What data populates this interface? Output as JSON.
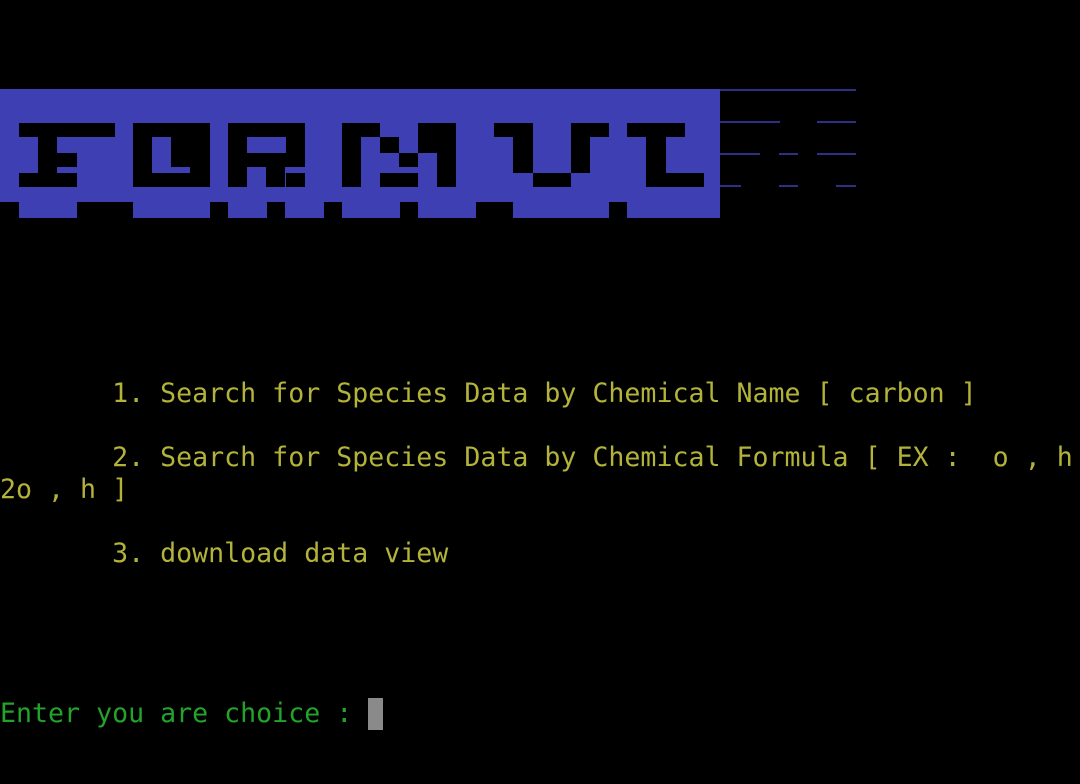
{
  "colors": {
    "background": "#000000",
    "menu_text": "#b3b33a",
    "prompt_text": "#22a32a",
    "banner": "#3f3fb4",
    "cursor": "#8a8a8a"
  },
  "banner": {
    "text": "FORMULA"
  },
  "menu": {
    "item1": "       1. Search for Species Data by Chemical Name [ carbon ]",
    "item2_line1": "       2. Search for Species Data by Chemical Formula [ EX :  o , h",
    "item2_line2": "2o , h ]",
    "item3": "       3. download data view"
  },
  "prompt": {
    "label": "Enter you are choice : "
  }
}
